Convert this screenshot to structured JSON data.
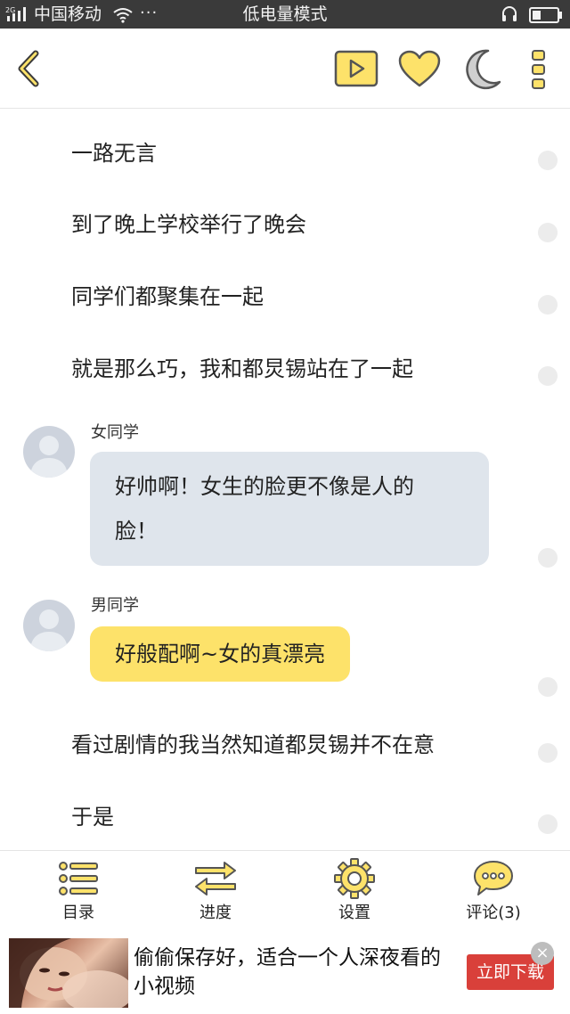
{
  "status_bar": {
    "network_type": "2G",
    "carrier": "中国移动",
    "dots": "···",
    "mode": "低电量模式"
  },
  "header": {
    "accent_color": "#fde26a",
    "icons": [
      "back-icon",
      "play-icon",
      "heart-icon",
      "moon-icon",
      "more-icon"
    ]
  },
  "story": {
    "lines_top": [
      "一路无言",
      "到了晚上学校举行了晚会",
      "同学们都聚集在一起",
      "就是那么巧，我和都炅锡站在了一起"
    ],
    "dialogues": [
      {
        "speaker": "女同学",
        "text_line1": "好帅啊！女生的脸更不像是人的",
        "text_line2": "脸！",
        "bubble_color": "#dfe5ec"
      },
      {
        "speaker": "男同学",
        "text_line1": "好般配啊~女的真漂亮",
        "bubble_color": "#fde26a"
      }
    ],
    "lines_bottom": [
      "看过剧情的我当然知道都炅锡并不在意",
      "于是"
    ]
  },
  "bottom_nav": {
    "items": [
      {
        "label": "目录",
        "icon": "list-icon"
      },
      {
        "label": "进度",
        "icon": "arrows-icon"
      },
      {
        "label": "设置",
        "icon": "gear-icon"
      },
      {
        "label": "评论(3)",
        "icon": "comment-icon"
      }
    ]
  },
  "ad": {
    "text": "偷偷保存好，适合一个人深夜看的小视频",
    "cta": "立即下载",
    "close": "×"
  }
}
